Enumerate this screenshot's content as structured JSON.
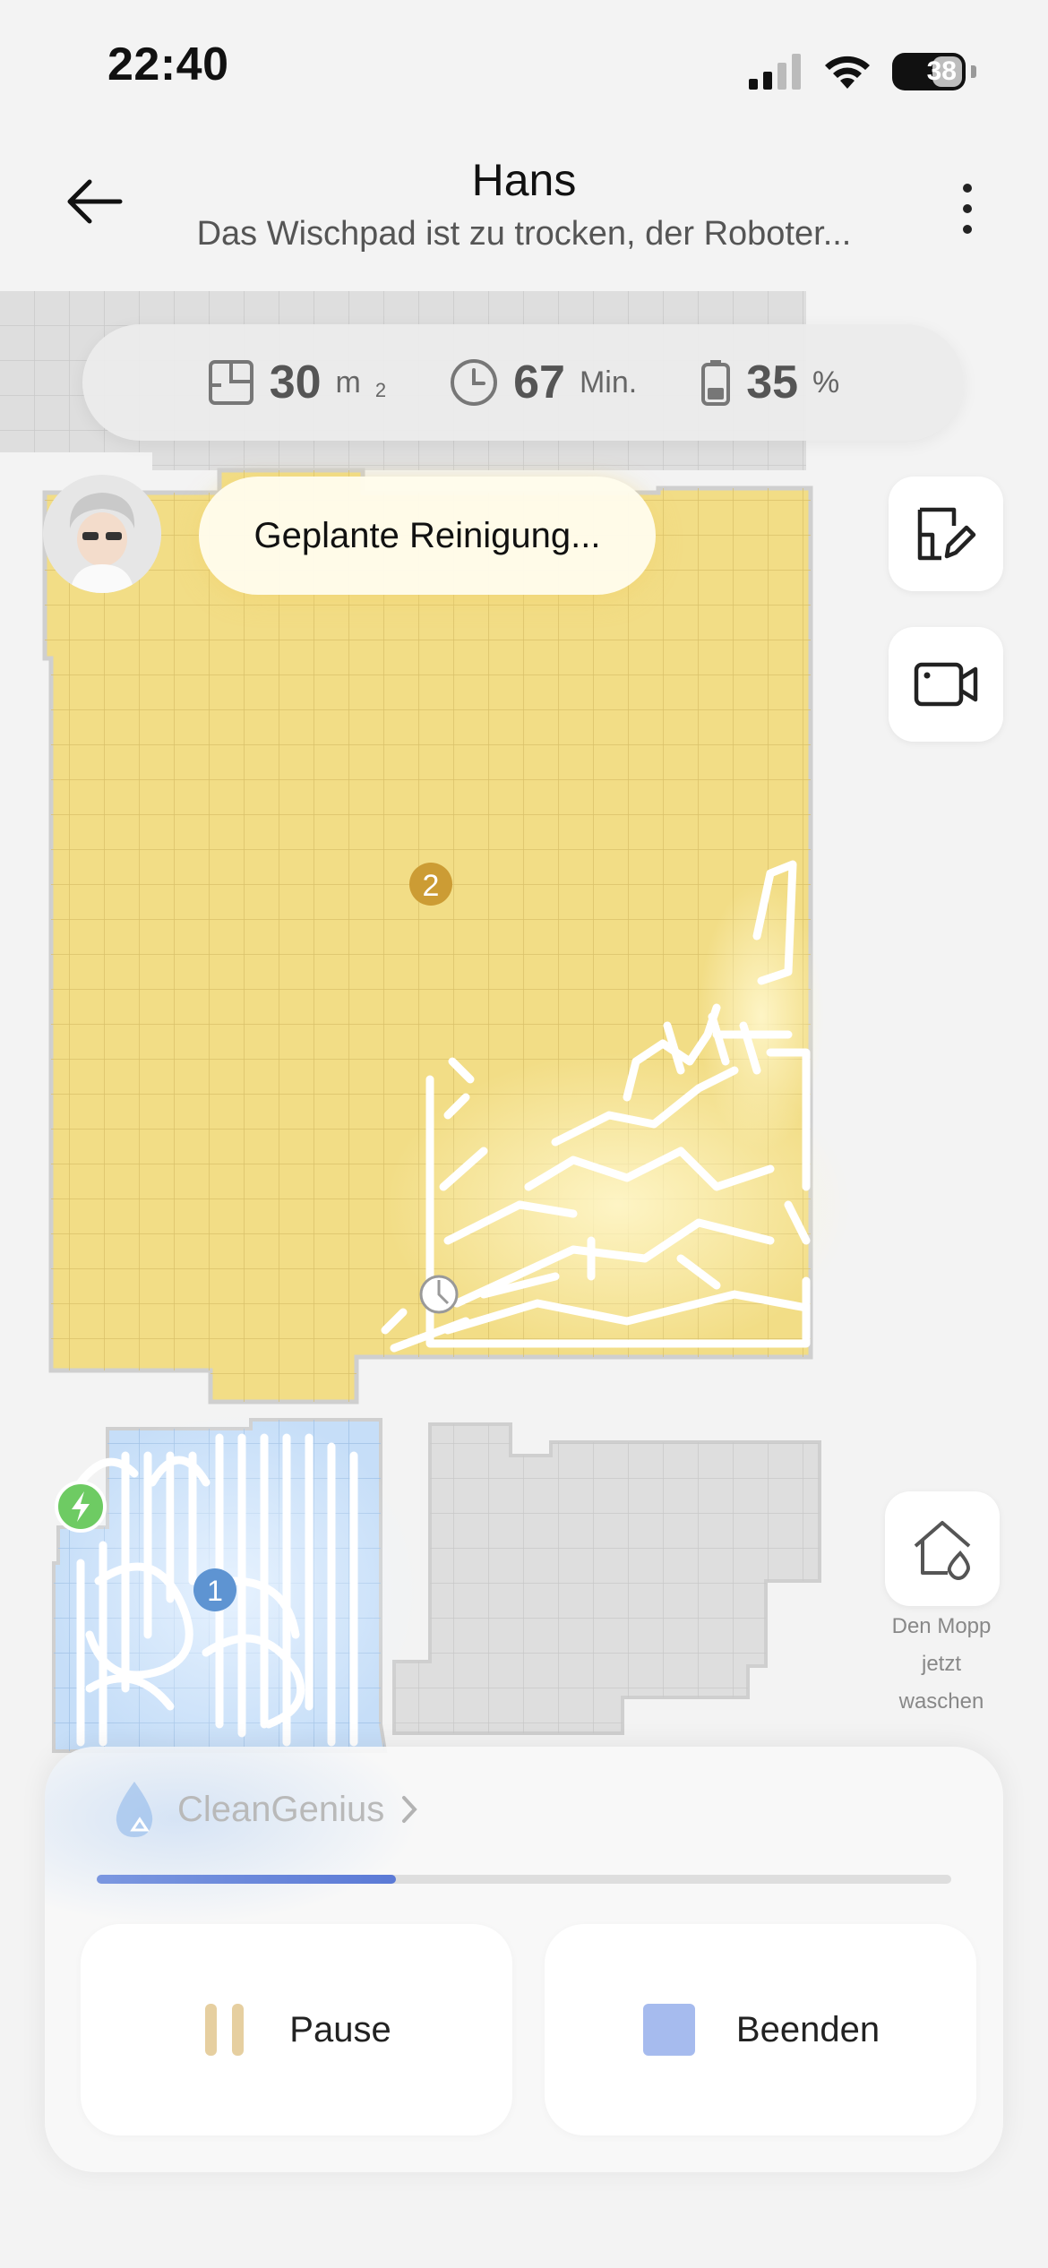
{
  "status_bar": {
    "time": "22:40",
    "battery": "38"
  },
  "header": {
    "title": "Hans",
    "subtitle": "Das Wischpad ist zu trocken, der Roboter..."
  },
  "stats": {
    "area_value": "30",
    "area_unit": "m",
    "area_sup": "2",
    "time_value": "67",
    "time_unit": "Min.",
    "battery_value": "35",
    "battery_unit": "%"
  },
  "robot_bubble": "Geplante Reinigung...",
  "map": {
    "rooms": [
      {
        "number": "2",
        "color": "#f2dd86"
      },
      {
        "number": "1",
        "color": "#c6def8"
      }
    ],
    "colors": {
      "wall": "#d0d0d0",
      "unexplored": "#dedede",
      "path": "#ffffff",
      "room_badge_2": "#cc9c34",
      "room_badge_1": "#5e94d2"
    }
  },
  "side_buttons": {
    "wash_mop_label": [
      "Den Mopp",
      "jetzt",
      "waschen"
    ]
  },
  "panel": {
    "clean_genius_label": "CleanGenius",
    "progress": 0.35,
    "pause_label": "Pause",
    "stop_label": "Beenden"
  }
}
